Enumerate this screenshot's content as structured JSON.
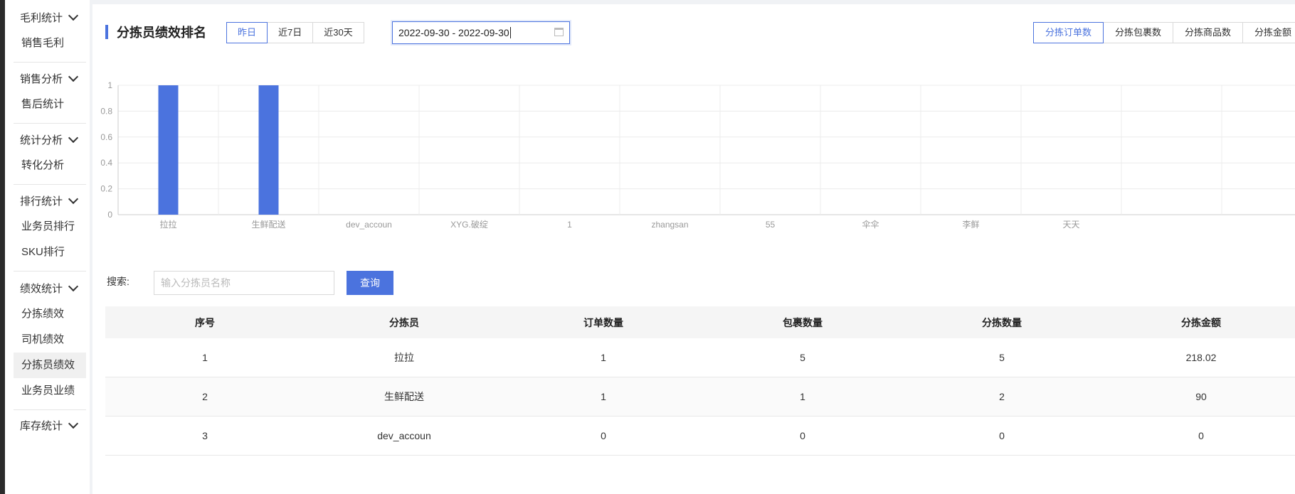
{
  "sidebar": {
    "groups": [
      {
        "title": "毛利统计",
        "items": [
          "销售毛利"
        ]
      },
      {
        "title": "销售分析",
        "items": [
          "售后统计"
        ]
      },
      {
        "title": "统计分析",
        "items": [
          "转化分析"
        ]
      },
      {
        "title": "排行统计",
        "items": [
          "业务员排行",
          "SKU排行"
        ]
      },
      {
        "title": "绩效统计",
        "items": [
          "分拣绩效",
          "司机绩效",
          "分拣员绩效",
          "业务员业绩"
        ]
      },
      {
        "title": "库存统计",
        "items": []
      }
    ],
    "active_item": "分拣员绩效"
  },
  "header": {
    "title": "分拣员绩效排名",
    "range_buttons": [
      "昨日",
      "近7日",
      "近30天"
    ],
    "active_range": "昨日",
    "date_range": "2022-09-30 - 2022-09-30",
    "metric_buttons": [
      "分拣订单数",
      "分拣包裹数",
      "分拣商品数",
      "分拣金额"
    ],
    "active_metric": "分拣订单数"
  },
  "chart_data": {
    "type": "bar",
    "categories": [
      "拉拉",
      "生鲜配送",
      "dev_accoun",
      "XYG.破绽",
      "1",
      "zhangsan",
      "55",
      "伞伞",
      "李鲜",
      "天天"
    ],
    "values": [
      1,
      1,
      0,
      0,
      0,
      0,
      0,
      0,
      0,
      0
    ],
    "ylim": [
      0,
      1
    ],
    "yticks": [
      "0",
      "0.2",
      "0.4",
      "0.6",
      "0.8",
      "1"
    ],
    "grid": true,
    "bar_color": "#4b73de"
  },
  "search": {
    "label": "搜索:",
    "placeholder": "输入分拣员名称",
    "button": "查询"
  },
  "table": {
    "columns": [
      "序号",
      "分拣员",
      "订单数量",
      "包裹数量",
      "分拣数量",
      "分拣金额"
    ],
    "rows": [
      [
        "1",
        "拉拉",
        "1",
        "5",
        "5",
        "218.02"
      ],
      [
        "2",
        "生鲜配送",
        "1",
        "1",
        "2",
        "90"
      ],
      [
        "3",
        "dev_accoun",
        "0",
        "0",
        "0",
        "0"
      ]
    ]
  },
  "colors": {
    "accent": "#4b73de",
    "sidebar_edge": "#2b2b2b"
  }
}
